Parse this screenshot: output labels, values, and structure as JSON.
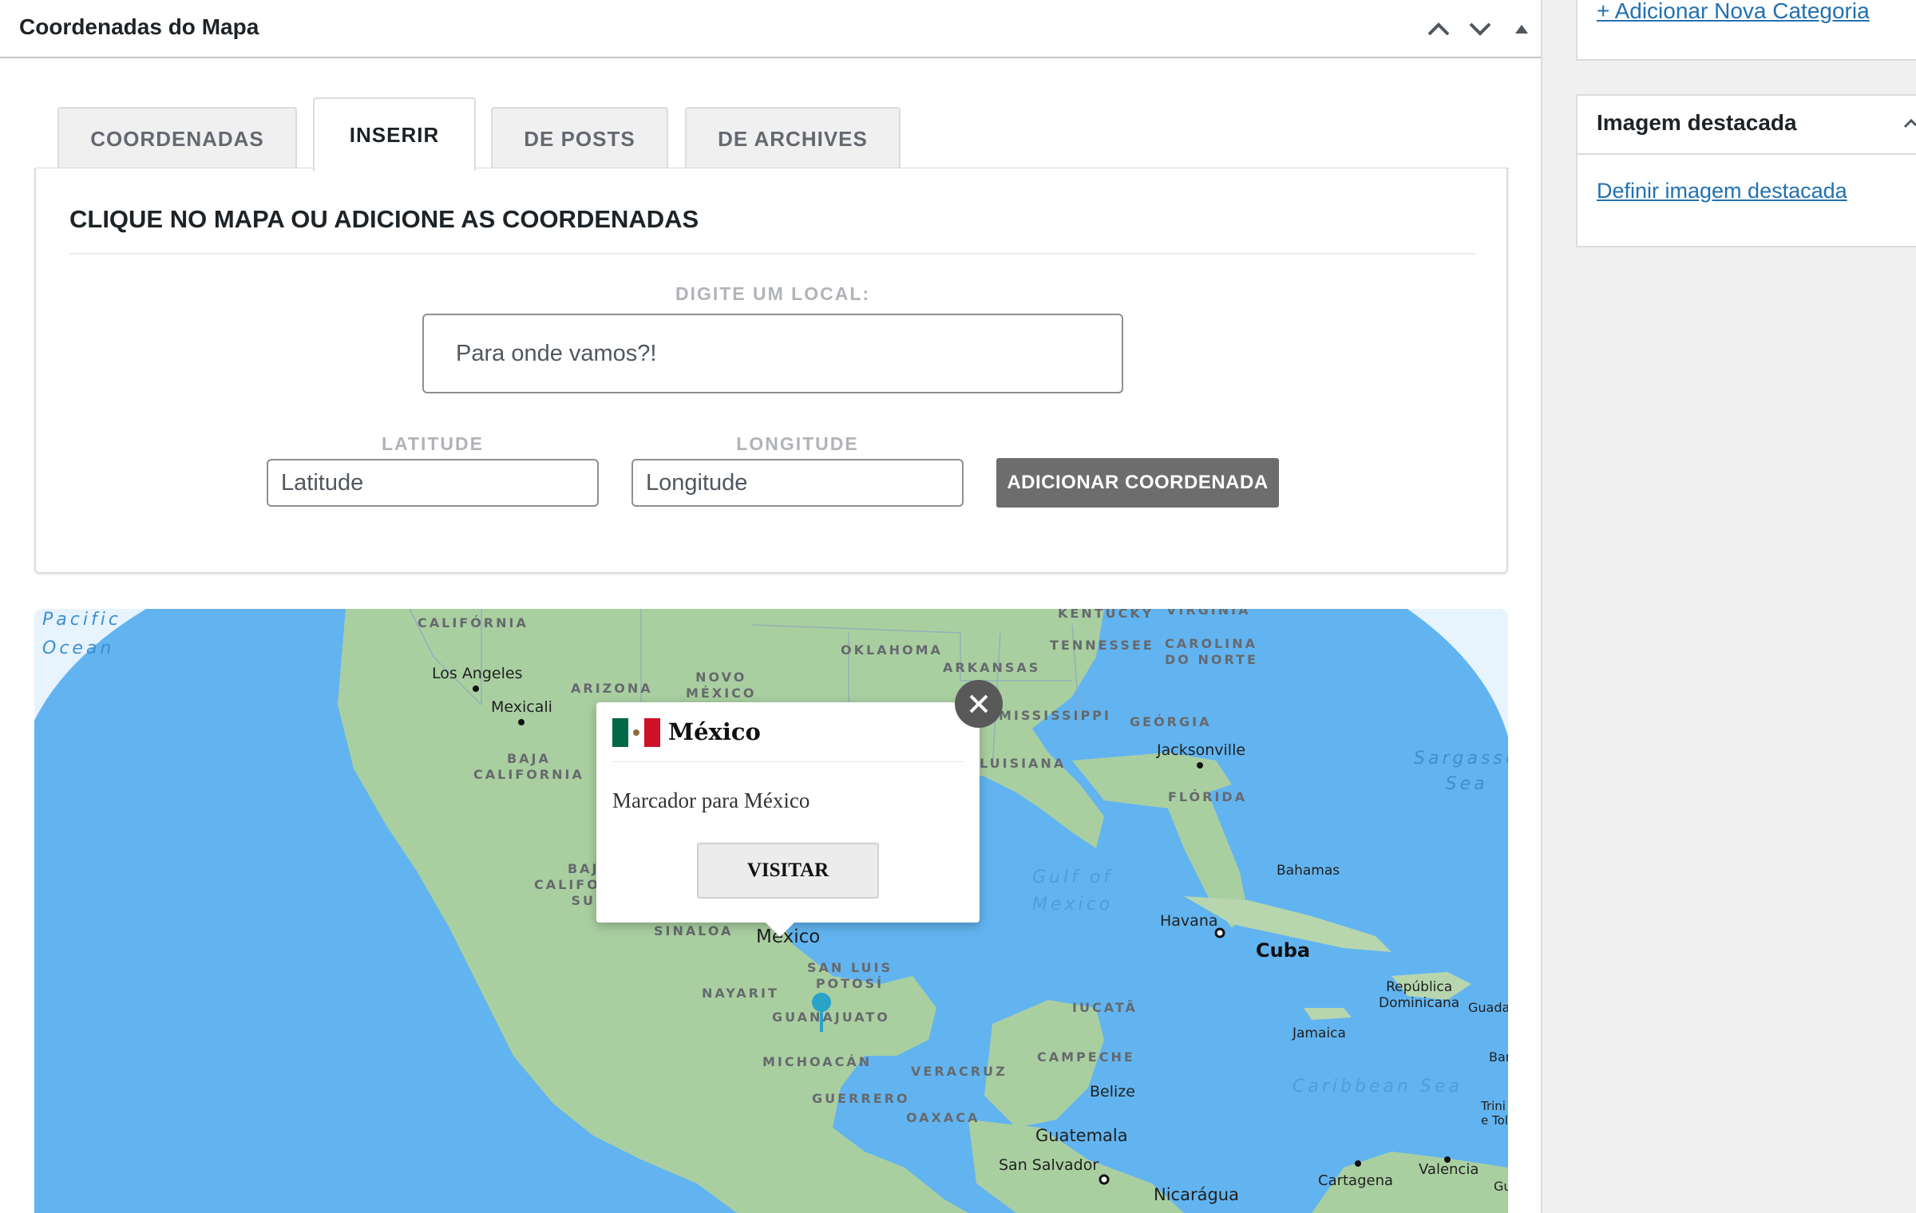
{
  "metabox": {
    "title": "Coordenadas do Mapa",
    "controls": [
      "move-up",
      "move-down",
      "toggle"
    ]
  },
  "tabs": [
    {
      "label": "COORDENADAS",
      "active": false
    },
    {
      "label": "INSERIR",
      "active": true
    },
    {
      "label": "DE POSTS",
      "active": false
    },
    {
      "label": "DE ARCHIVES",
      "active": false
    }
  ],
  "form": {
    "heading": "CLIQUE NO MAPA OU ADICIONE AS COORDENADAS",
    "location_label": "DIGITE UM LOCAL:",
    "location_placeholder": "Para onde vamos?!",
    "latitude_label": "LATITUDE",
    "latitude_placeholder": "Latitude",
    "longitude_label": "LONGITUDE",
    "longitude_placeholder": "Longitude",
    "add_button": "ADICIONAR COORDENADA"
  },
  "map": {
    "labels": {
      "pacific": "Pacific\nOcean",
      "california": "CALIFÓRNIA",
      "los_angeles": "Los Angeles",
      "mexicali": "Mexicali",
      "arizona": "ARIZONA",
      "novo_mexico": "NOVO\nMÉXICO",
      "oklahoma": "OKLAHOMA",
      "arkansas": "ARKANSAS",
      "kentucky": "KENTUCKY",
      "virginia": "VIRGINIA",
      "tennessee": "TENNESSEE",
      "carolina": "CAROLINA\nDO NORTE",
      "mississippi": "MISSISSIPPI",
      "georgia": "GEÓRGIA",
      "jacksonville": "Jacksonville",
      "luisiana": "LUISIANA",
      "florida": "FLÓRIDA",
      "sargasso": "Sargasso\nSea",
      "baja_california": "BAJA\nCALIFORNIA",
      "baja_california_sur": "BAJA\nCALIFORNIA\nSUR",
      "gulf": "Gulf of\nMexico",
      "bahamas": "Bahamas",
      "havana": "Havana",
      "cuba": "Cuba",
      "sinaloa": "SINALOA",
      "mexico_city": "México",
      "san_luis": "SAN LUIS\nPOTOSÍ",
      "nayarit": "NAYARIT",
      "guanajuato": "GUANAJUATO",
      "iucata": "IUCATÃ",
      "republica": "República\nDominicana",
      "guadeloupe": "Guada",
      "jamaica": "Jamaica",
      "campeche": "CAMPECHE",
      "michoacan": "MICHOACÁN",
      "veracruz": "VERACRUZ",
      "belize": "Belize",
      "caribbean": "Caribbean Sea",
      "barbados": "Bar",
      "guerrero": "GUERRERO",
      "oaxaca": "OAXACA",
      "trinidad": "Trini\ne Tol",
      "guatemala": "Guatemala",
      "san_salvador": "San Salvador",
      "valencia": "Valencia",
      "cartagena": "Cartagena",
      "nicaragua": "Nicarágua",
      "guiana": "Gu"
    },
    "popup": {
      "title": "México",
      "text": "Marcador para México",
      "button": "VISITAR"
    }
  },
  "sidebar": {
    "add_category": "+ Adicionar Nova Categoria",
    "featured_title": "Imagem destacada",
    "featured_link": "Definir imagem destacada"
  },
  "colors": {
    "ocean": "#62b4f0",
    "land": "#a9cfa1",
    "button_dark": "#6d6d6d",
    "link": "#2271b1"
  }
}
